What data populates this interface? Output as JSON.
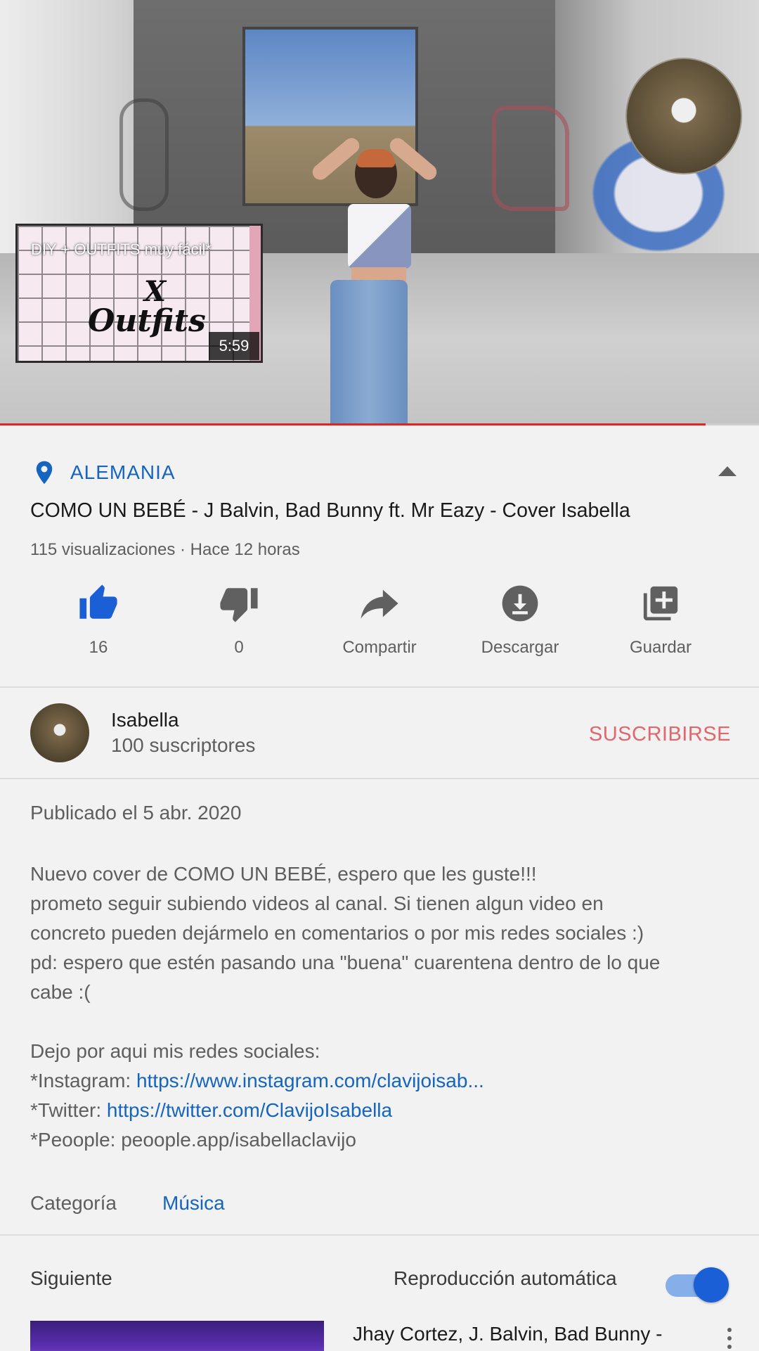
{
  "player": {
    "end_card": {
      "title": "DIY + OUTFITS  muy fácil*",
      "duration": "5:59",
      "thumb_text_x": "X",
      "thumb_text_outfits": "Outfits"
    },
    "progress": 0.93,
    "progress_color": "#e02424"
  },
  "location": {
    "icon": "location-pin-icon",
    "label": "ALEMANIA"
  },
  "video": {
    "title": "COMO UN BEBÉ - J Balvin, Bad Bunny ft. Mr Eazy - Cover Isabella",
    "meta": "115 visualizaciones · Hace 12 horas"
  },
  "actions": [
    {
      "icon": "thumbs-up-icon",
      "label": "16"
    },
    {
      "icon": "thumbs-down-icon",
      "label": "0"
    },
    {
      "icon": "share-icon",
      "label": "Compartir"
    },
    {
      "icon": "download-icon",
      "label": "Descargar"
    },
    {
      "icon": "add-to-playlist-icon",
      "label": "Guardar"
    }
  ],
  "channel": {
    "name": "Isabella",
    "subscribers": "100 suscriptores",
    "subscribe_label": "SUSCRIBIRSE"
  },
  "description": {
    "published": "Publicado el 5 abr. 2020",
    "lines": [
      "Nuevo cover de COMO UN BEBÉ, espero que les guste!!!",
      "prometo seguir subiendo videos al canal. Si tienen algun video en",
      "concreto pueden dejármelo en comentarios o por mis redes sociales :)",
      "pd: espero que estén pasando una \"buena\" cuarentena dentro de lo que",
      "cabe :(",
      "",
      "Dejo por aqui mis redes sociales:"
    ],
    "instagram_prefix": "*Instagram: ",
    "instagram_link": "https://www.instagram.com/clavijoisab...",
    "twitter_prefix": "*Twitter: ",
    "twitter_link": "https://twitter.com/ClavijoIsabella",
    "peoople": "*Peoople: peoople.app/isabellaclavijo"
  },
  "category": {
    "label": "Categoría",
    "value": "Música"
  },
  "up_next": {
    "label": "Siguiente",
    "autoplay_label": "Reproducción automática",
    "autoplay_on": true,
    "item_title": "Jhay Cortez, J. Balvin, Bad Bunny -"
  },
  "colors": {
    "accent_blue": "#1565c0",
    "subscribe_red": "#e0676b",
    "toggle_blue": "#1a5fd6"
  }
}
